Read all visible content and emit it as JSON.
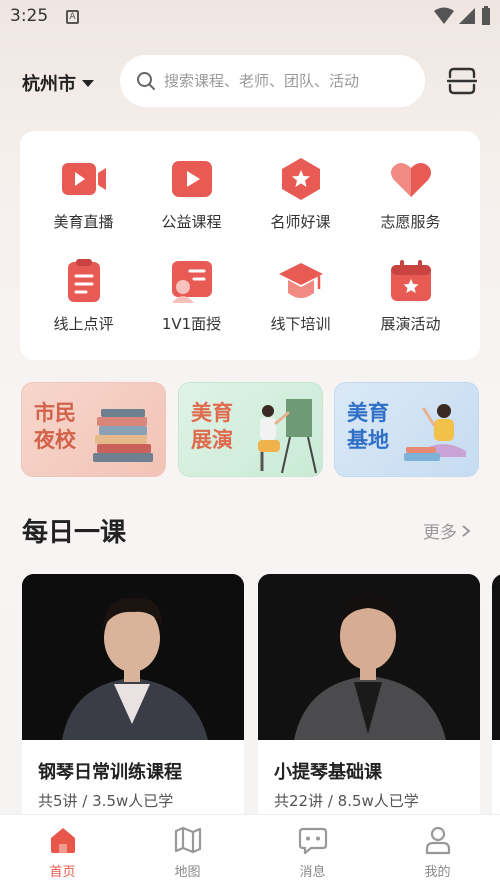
{
  "status_bar": {
    "time": "3:25",
    "notif_glyph": "A"
  },
  "header": {
    "city": "杭州市",
    "search_placeholder": "搜索课程、老师、团队、活动",
    "scan_icon": "scan-icon"
  },
  "menu": [
    {
      "label": "美育直播",
      "icon": "live-video-icon"
    },
    {
      "label": "公益课程",
      "icon": "play-icon"
    },
    {
      "label": "名师好课",
      "icon": "star-badge-icon"
    },
    {
      "label": "志愿服务",
      "icon": "heart-icon"
    },
    {
      "label": "线上点评",
      "icon": "clipboard-icon"
    },
    {
      "label": "1V1面授",
      "icon": "one-on-one-icon"
    },
    {
      "label": "线下培训",
      "icon": "graduation-cap-icon"
    },
    {
      "label": "展演活动",
      "icon": "calendar-star-icon"
    }
  ],
  "banners": [
    {
      "line1": "市民",
      "line2": "夜校"
    },
    {
      "line1": "美育",
      "line2": "展演"
    },
    {
      "line1": "美育",
      "line2": "基地"
    }
  ],
  "daily": {
    "title": "每日一课",
    "more": "更多",
    "courses": [
      {
        "title": "钢琴日常训练课程",
        "meta": "共5讲 / 3.5w人已学"
      },
      {
        "title": "小提琴基础课",
        "meta": "共22讲 / 8.5w人已学"
      }
    ]
  },
  "tabs": [
    {
      "label": "首页",
      "active": true
    },
    {
      "label": "地图",
      "active": false
    },
    {
      "label": "消息",
      "active": false
    },
    {
      "label": "我的",
      "active": false
    }
  ],
  "colors": {
    "accent": "#e8574a",
    "icon_red": "#e85b55",
    "icon_pink": "#f39a8e"
  }
}
